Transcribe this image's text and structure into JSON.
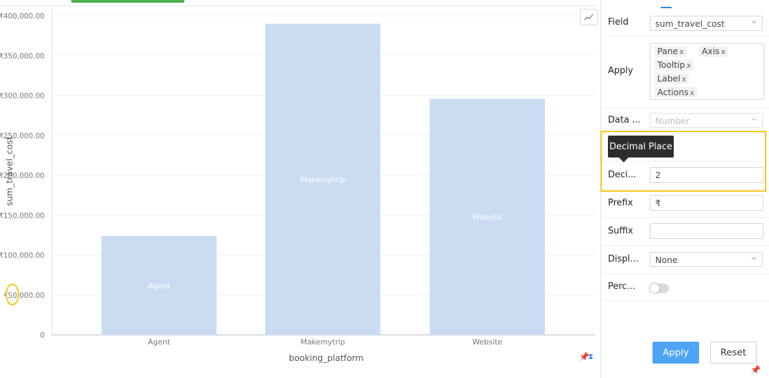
{
  "chart_data": {
    "type": "bar",
    "categories": [
      "Agent",
      "Makemytrip",
      "Website"
    ],
    "values": [
      124000,
      390000,
      296000
    ],
    "bar_labels": [
      "Agent",
      "Makemytrip",
      "Website"
    ],
    "xlabel": "booking_platform",
    "ylabel": "sum_travel_cost",
    "ylim": [
      0,
      400000
    ],
    "yticks": [
      "0",
      "₹50,000.00",
      "₹100,000.00",
      "₹150,000.00",
      "₹200,000.00",
      "₹250,000.00",
      "₹300,000.00",
      "₹350,000.00",
      "₹400,000.00"
    ],
    "grid": true,
    "bar_color": "#c9dcf2"
  },
  "panel": {
    "field_label": "Field",
    "field_value": "sum_travel_cost",
    "apply_label": "Apply",
    "apply_chips": [
      "Pane",
      "Axis",
      "Tooltip",
      "Label",
      "Actions"
    ],
    "chip_remove": "x",
    "data_type_label": "Data ...",
    "data_type_value": "Number",
    "tooltip_text": "Decimal Place",
    "decimal_label": "Deci...",
    "decimal_value": "2",
    "prefix_label": "Prefix",
    "prefix_value": "₹",
    "suffix_label": "Suffix",
    "suffix_value": "",
    "display_label": "Displ...",
    "display_value": "None",
    "percent_label": "Perc...",
    "percent_on": false,
    "apply_button": "Apply",
    "reset_button": "Reset"
  },
  "colors": {
    "accent": "#4ea4f5",
    "highlight": "#f5c518",
    "top_tab": "#4caf50"
  }
}
